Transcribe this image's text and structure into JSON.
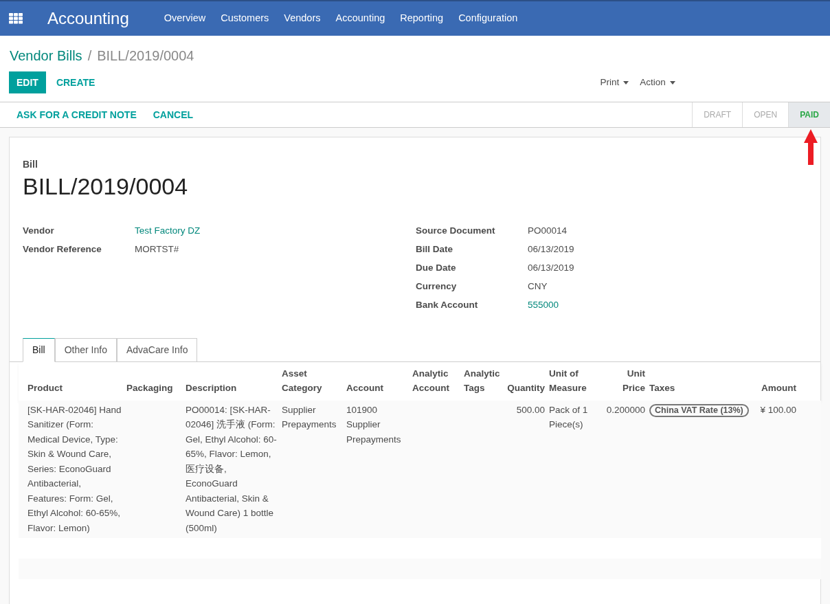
{
  "navbar": {
    "app_title": "Accounting",
    "menu": [
      "Overview",
      "Customers",
      "Vendors",
      "Accounting",
      "Reporting",
      "Configuration"
    ]
  },
  "breadcrumb": {
    "parent": "Vendor Bills",
    "separator": "/",
    "current": "BILL/2019/0004"
  },
  "buttons": {
    "edit": "EDIT",
    "create": "CREATE",
    "print": "Print",
    "action": "Action"
  },
  "statusbar": {
    "actions": [
      "ASK FOR A CREDIT NOTE",
      "CANCEL"
    ],
    "steps": [
      {
        "label": "DRAFT",
        "selected": false
      },
      {
        "label": "OPEN",
        "selected": false
      },
      {
        "label": "PAID",
        "selected": true
      }
    ]
  },
  "form": {
    "type_label": "Bill",
    "name": "BILL/2019/0004",
    "left_fields": [
      {
        "label": "Vendor",
        "value": "Test Factory DZ",
        "link": true
      },
      {
        "label": "Vendor Reference",
        "value": "MORTST#",
        "link": false
      }
    ],
    "right_fields": [
      {
        "label": "Source Document",
        "value": "PO00014",
        "link": false
      },
      {
        "label": "Bill Date",
        "value": "06/13/2019",
        "link": false
      },
      {
        "label": "Due Date",
        "value": "06/13/2019",
        "link": false
      },
      {
        "label": "Currency",
        "value": "CNY",
        "link": false
      },
      {
        "label": "Bank Account",
        "value": "555000",
        "link": true
      }
    ]
  },
  "tabs": [
    {
      "label": "Bill",
      "selected": true
    },
    {
      "label": "Other Info",
      "selected": false
    },
    {
      "label": "AdvaCare Info",
      "selected": false
    }
  ],
  "table": {
    "columns": [
      {
        "label": "Product",
        "kind": "text"
      },
      {
        "label": "Packaging",
        "kind": "text"
      },
      {
        "label": "Description",
        "kind": "text"
      },
      {
        "label": "Asset Category",
        "kind": "text"
      },
      {
        "label": "Account",
        "kind": "text"
      },
      {
        "label": "Analytic Account",
        "kind": "text"
      },
      {
        "label": "Analytic Tags",
        "kind": "text"
      },
      {
        "label": "Quantity",
        "kind": "number"
      },
      {
        "label": "Unit of Measure",
        "kind": "text"
      },
      {
        "label": "Unit Price",
        "kind": "number"
      },
      {
        "label": "Taxes",
        "kind": "tags"
      },
      {
        "label": "Amount",
        "kind": "number"
      }
    ],
    "rows": [
      {
        "cells": [
          "[SK-HAR-02046] Hand Sanitizer (Form: Medical Device, Type: Skin & Wound Care, Series: EconoGuard Antibacterial, Features: Form: Gel, Ethyl Alcohol: 60-65%, Flavor: Lemon)",
          "",
          "PO00014: [SK-HAR-02046] 洗手液 (Form: Gel, Ethyl Alcohol: 60-65%, Flavor: Lemon, 医疗设备, EconoGuard Antibacterial, Skin & Wound Care) 1 bottle (500ml)",
          "Supplier Prepayments",
          "101900 Supplier Prepayments",
          "",
          "",
          "500.00",
          "Pack of 1 Piece(s)",
          "0.200000",
          "",
          "¥ 100.00"
        ],
        "tax_tags": [
          "China VAT Rate (13%)"
        ]
      }
    ]
  }
}
